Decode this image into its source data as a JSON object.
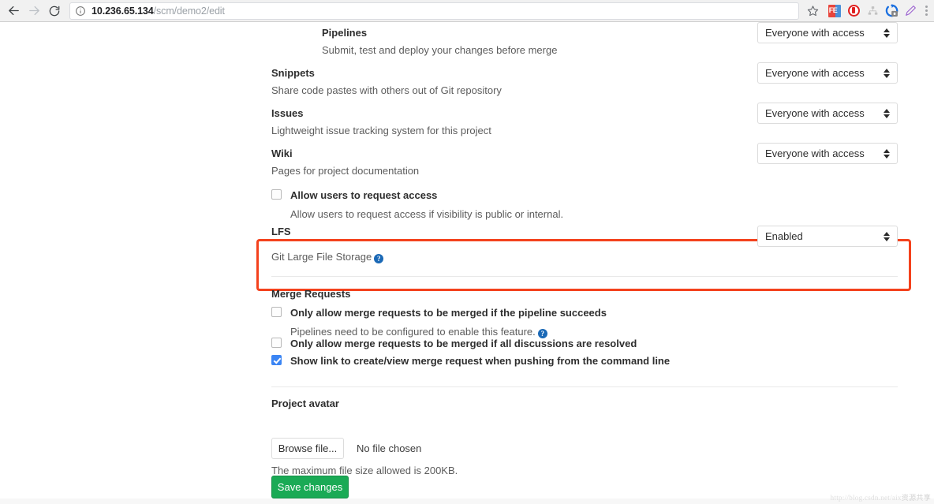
{
  "browser": {
    "back_icon": "back-arrow-icon",
    "forward_icon": "forward-arrow-icon",
    "reload_icon": "reload-icon",
    "site_info_icon": "info-circle-icon",
    "url_host": "10.236.65.134",
    "url_path": "/scm/demo2/edit",
    "url_full": "10.236.65.134/scm/demo2/edit",
    "bookmark_icon": "star-icon",
    "extensions": [
      {
        "name": "ext-fe-icon",
        "label": "FE"
      },
      {
        "name": "ext-shield-icon",
        "label": ""
      },
      {
        "name": "ext-gray-org-icon",
        "label": ""
      },
      {
        "name": "ext-sync-icon",
        "label": ""
      },
      {
        "name": "ext-pen-icon",
        "label": ""
      }
    ],
    "menu_icon": "kebab-menu-icon"
  },
  "features": [
    {
      "title": "Pipelines",
      "desc": "Submit, test and deploy your changes before merge",
      "select_value": "Everyone with access",
      "indented": true
    },
    {
      "title": "Snippets",
      "desc": "Share code pastes with others out of Git repository",
      "select_value": "Everyone with access",
      "indented": false
    },
    {
      "title": "Issues",
      "desc": "Lightweight issue tracking system for this project",
      "select_value": "Everyone with access",
      "indented": false
    },
    {
      "title": "Wiki",
      "desc": "Pages for project documentation",
      "select_value": "Everyone with access",
      "indented": false
    }
  ],
  "request_access": {
    "label": "Allow users to request access",
    "desc": "Allow users to request access if visibility is public or internal.",
    "checked": false
  },
  "lfs": {
    "title": "LFS",
    "desc": "Git Large File Storage",
    "help_icon": "help-circle-icon",
    "select_value": "Enabled",
    "highlight_color": "#f4421d"
  },
  "merge_requests": {
    "section_title": "Merge Requests",
    "options": [
      {
        "label": "Only allow merge requests to be merged if the pipeline succeeds",
        "sub": "Pipelines need to be configured to enable this feature.",
        "sub_help_icon": "help-circle-icon",
        "checked": false
      },
      {
        "label": "Only allow merge requests to be merged if all discussions are resolved",
        "sub": "",
        "checked": false
      },
      {
        "label": "Show link to create/view merge request when pushing from the command line",
        "sub": "",
        "checked": true
      }
    ]
  },
  "project_avatar": {
    "section_title": "Project avatar",
    "browse_label": "Browse file...",
    "no_file_text": "No file chosen",
    "max_size_text": "The maximum file size allowed is 200KB."
  },
  "save": {
    "label": "Save changes",
    "color": "#1aaa55"
  },
  "watermark": {
    "url": "http://blog.csdn.net/aix",
    "suffix": "资源共享"
  }
}
